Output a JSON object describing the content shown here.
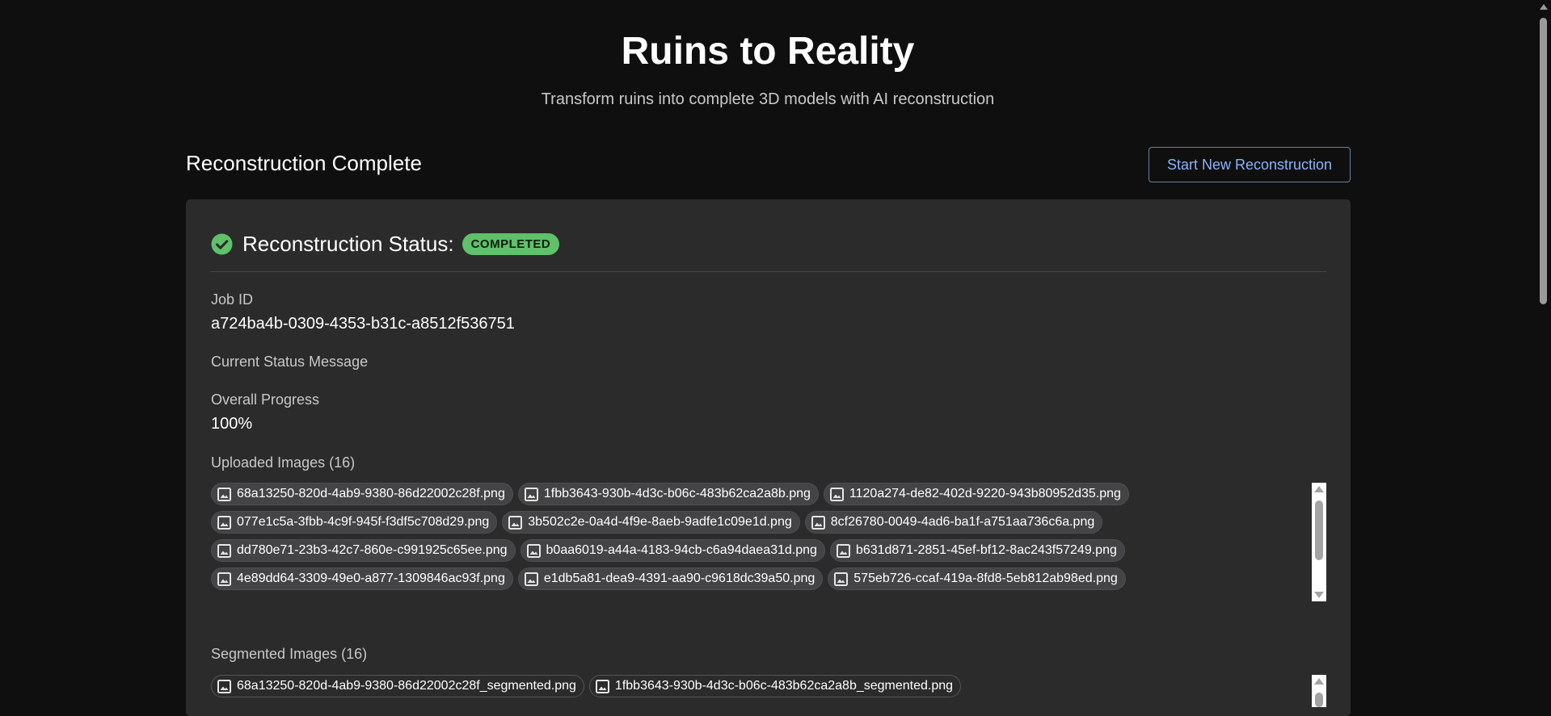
{
  "header": {
    "title": "Ruins to Reality",
    "subtitle": "Transform ruins into complete 3D models with AI reconstruction"
  },
  "section": {
    "heading": "Reconstruction Complete",
    "new_button": "Start New Reconstruction"
  },
  "status": {
    "label": "Reconstruction Status:",
    "badge": "COMPLETED",
    "badge_color": "#5fc16a"
  },
  "job": {
    "label": "Job ID",
    "value": "a724ba4b-0309-4353-b31c-a8512f536751"
  },
  "message": {
    "label": "Current Status Message"
  },
  "progress": {
    "label": "Overall Progress",
    "value": "100%"
  },
  "uploaded": {
    "label": "Uploaded Images (16)",
    "items": [
      "68a13250-820d-4ab9-9380-86d22002c28f.png",
      "1fbb3643-930b-4d3c-b06c-483b62ca2a8b.png",
      "1120a274-de82-402d-9220-943b80952d35.png",
      "077e1c5a-3fbb-4c9f-945f-f3df5c708d29.png",
      "3b502c2e-0a4d-4f9e-8aeb-9adfe1c09e1d.png",
      "8cf26780-0049-4ad6-ba1f-a751aa736c6a.png",
      "dd780e71-23b3-42c7-860e-c991925c65ee.png",
      "b0aa6019-a44a-4183-94cb-c6a94daea31d.png",
      "b631d871-2851-45ef-bf12-8ac243f57249.png",
      "4e89dd64-3309-49e0-a877-1309846ac93f.png",
      "e1db5a81-dea9-4391-aa90-c9618dc39a50.png",
      "575eb726-ccaf-419a-8fd8-5eb812ab98ed.png"
    ]
  },
  "segmented": {
    "label": "Segmented Images (16)",
    "items": [
      "68a13250-820d-4ab9-9380-86d22002c28f_segmented.png",
      "1fbb3643-930b-4d3c-b06c-483b62ca2a8b_segmented.png"
    ]
  }
}
